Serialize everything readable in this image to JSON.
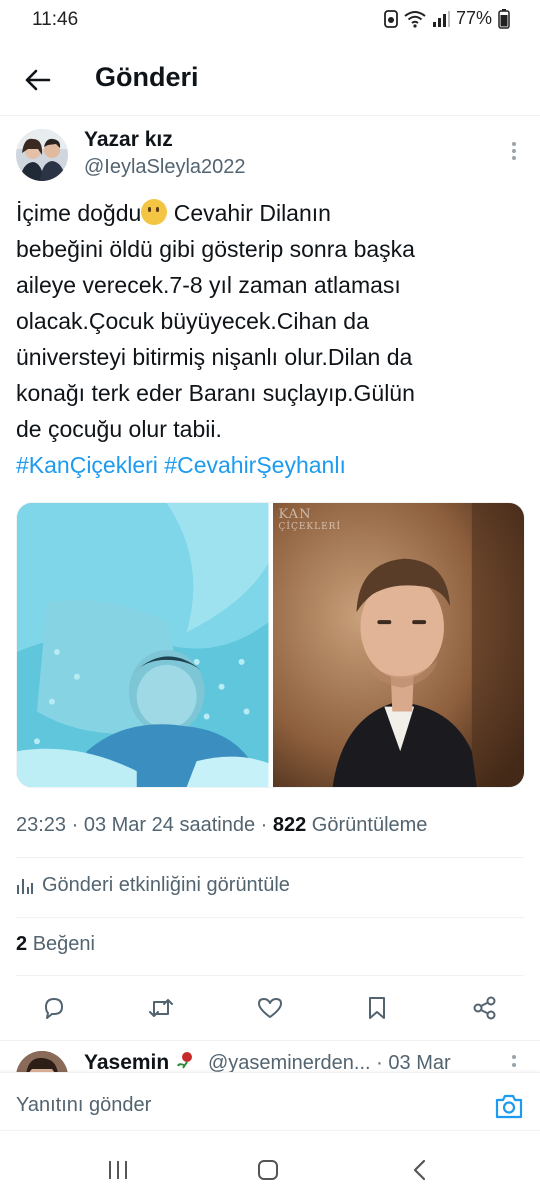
{
  "status": {
    "time": "11:46",
    "battery": "77%",
    "icons": [
      "notification-icon",
      "wifi-icon",
      "signal-icon",
      "battery-icon"
    ]
  },
  "header": {
    "title": "Gönderi",
    "back_icon": "arrow-left-icon"
  },
  "post": {
    "author_name": "Yazar kız",
    "author_handle": "@IeylaSleyla2022",
    "text_lines": [
      "İçime doğdu",
      " Cevahir Dilanın",
      "bebeğini öldü gibi gösterip sonra başka",
      "aileye verecek.7-8 yıl zaman atlaması",
      "olacak.Çocuk büyüyecek.Cihan da",
      "üniversteyi bitirmiş nişanlı olur.Dilan da",
      "konağı terk eder Baranı suçlayıp.Gülün",
      "de çocuğu olur tabii."
    ],
    "emoji": "thinking-face-emoji",
    "hashtags": [
      "#KanÇiçekleri",
      "#CevahirŞeyhanlı"
    ],
    "media_logo": [
      "KAN",
      "ÇİÇEKLERİ"
    ],
    "time": "23:23",
    "date": "03 Mar 24 saatinde",
    "views_count": "822",
    "views_label": "Görüntüleme",
    "analytics_label": "Gönderi etkinliğini görüntüle",
    "likes_count": "2",
    "likes_label": "Beğeni"
  },
  "actions": [
    "reply-icon",
    "retweet-icon",
    "like-icon",
    "bookmark-icon",
    "share-icon"
  ],
  "reply": {
    "name": "Yasemin",
    "handle": "@yaseminerden...",
    "date": "· 03 Mar"
  },
  "composer": {
    "placeholder": "Yanıtını gönder",
    "camera_icon": "camera-icon"
  },
  "colors": {
    "accent": "#1d9bf0",
    "text": "#0f1419",
    "secondary": "#536471"
  }
}
